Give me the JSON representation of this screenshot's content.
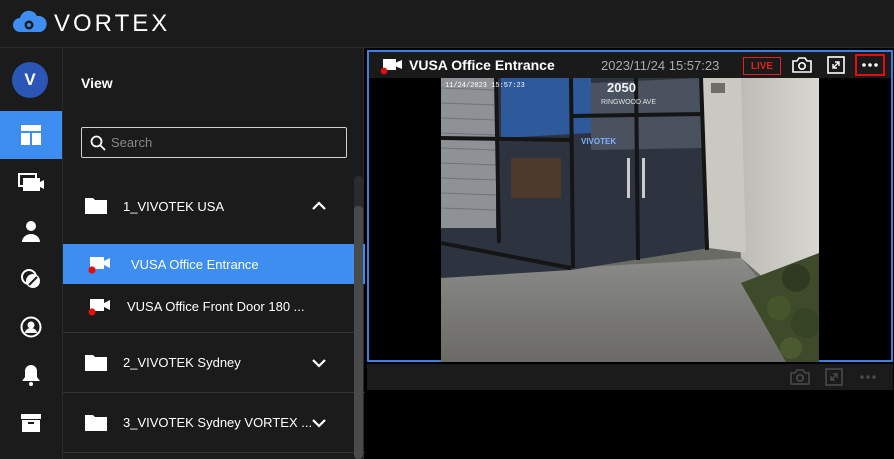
{
  "app": {
    "brand": "VORTEX",
    "brand_color": "#3d8ef0"
  },
  "user": {
    "initial": "V"
  },
  "rail": {
    "items": [
      {
        "name": "layout-icon",
        "active": true
      },
      {
        "name": "cameras-icon",
        "active": false
      },
      {
        "name": "user-icon",
        "active": false
      },
      {
        "name": "tags-icon",
        "active": false
      },
      {
        "name": "account-icon",
        "active": false
      },
      {
        "name": "bell-icon",
        "active": false
      },
      {
        "name": "archive-icon",
        "active": false
      }
    ]
  },
  "panel": {
    "title": "View",
    "search_placeholder": "Search",
    "groups": [
      {
        "label": "1_VIVOTEK USA",
        "expanded": true,
        "cameras": [
          {
            "label": "VUSA Office Entrance",
            "selected": true
          },
          {
            "label": "VUSA Office Front Door 180 ...",
            "selected": false
          }
        ]
      },
      {
        "label": "2_VIVOTEK Sydney",
        "expanded": false
      },
      {
        "label": "3_VIVOTEK Sydney VORTEX ...",
        "expanded": false
      }
    ]
  },
  "tile": {
    "title": "VUSA Office Entrance",
    "timestamp": "2023/11/24 15:57:23",
    "live_label": "LIVE",
    "live_color": "#e02020",
    "selected_border_color": "#3d7ee0",
    "video_overlay": "11/24/2023 15:57:23",
    "building_number": "2050",
    "street_name": "RINGWOOD AVE",
    "door_logo": "VIVOTEK"
  }
}
